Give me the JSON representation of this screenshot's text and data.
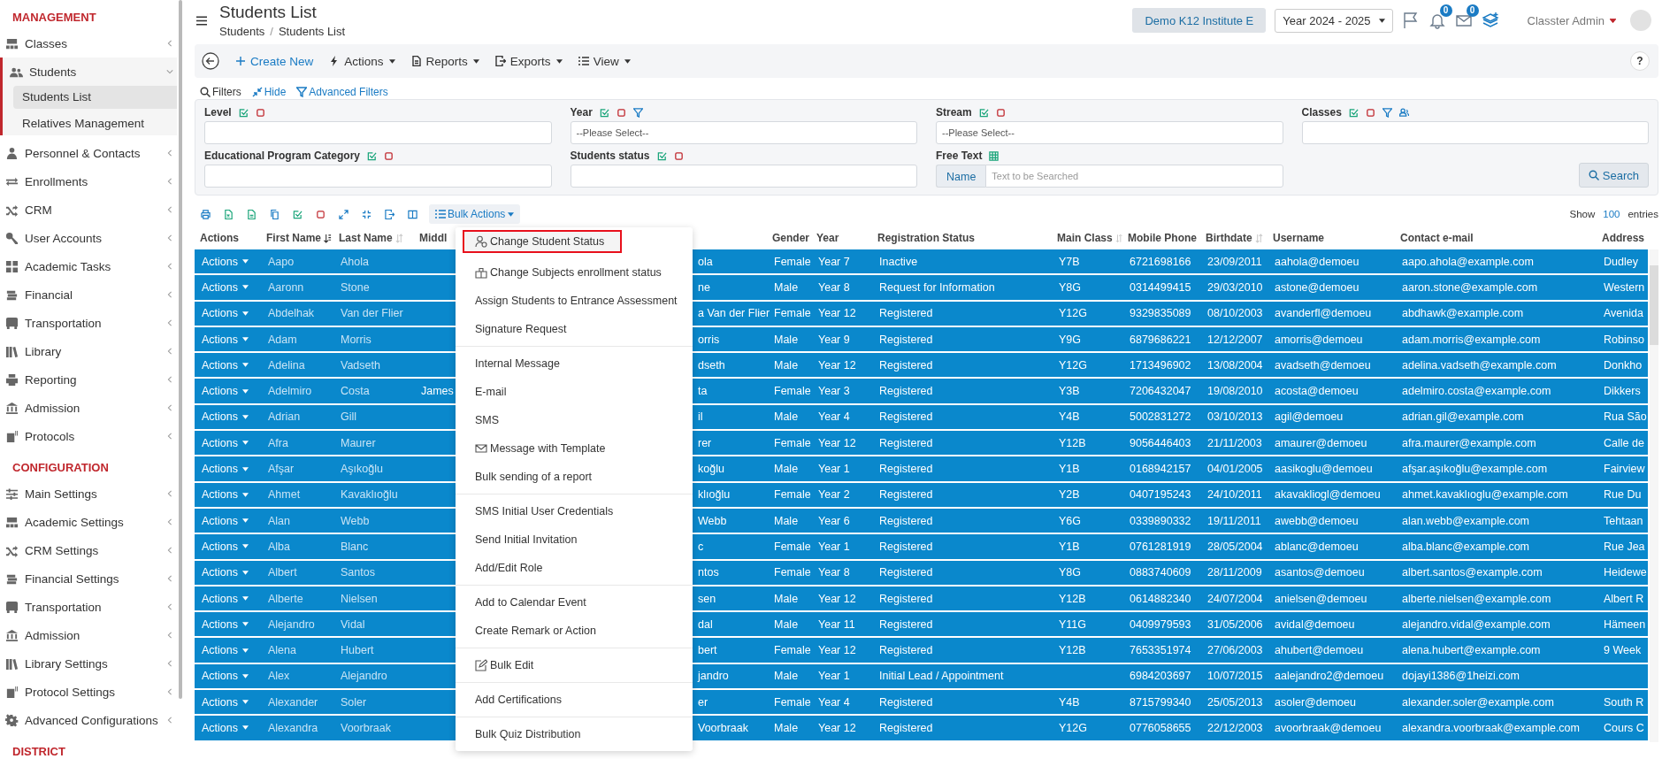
{
  "sidebar": {
    "sections": [
      {
        "title": "MANAGEMENT",
        "items": [
          {
            "label": "Classes",
            "kind": "classroom",
            "expanded": false
          },
          {
            "label": "Students",
            "kind": "people",
            "expanded": true,
            "children": [
              {
                "label": "Students List",
                "selected": true
              },
              {
                "label": "Relatives Management",
                "selected": false
              }
            ]
          },
          {
            "label": "Personnel & Contacts",
            "kind": "person",
            "expanded": false
          },
          {
            "label": "Enrollments",
            "kind": "arrows",
            "expanded": false
          },
          {
            "label": "CRM",
            "kind": "shuffle",
            "expanded": false
          },
          {
            "label": "User Accounts",
            "kind": "key",
            "expanded": false
          },
          {
            "label": "Academic Tasks",
            "kind": "grid",
            "expanded": false
          },
          {
            "label": "Financial",
            "kind": "coins",
            "expanded": false
          },
          {
            "label": "Transportation",
            "kind": "bus",
            "expanded": false
          },
          {
            "label": "Library",
            "kind": "books",
            "expanded": false
          },
          {
            "label": "Reporting",
            "kind": "printer",
            "expanded": false
          },
          {
            "label": "Admission",
            "kind": "bank",
            "expanded": false
          },
          {
            "label": "Protocols",
            "kind": "cabinet",
            "expanded": false
          }
        ]
      },
      {
        "title": "CONFIGURATION",
        "items": [
          {
            "label": "Main Settings",
            "kind": "sliders",
            "expanded": false
          },
          {
            "label": "Academic Settings",
            "kind": "classroom",
            "expanded": false
          },
          {
            "label": "CRM Settings",
            "kind": "shuffle",
            "expanded": false
          },
          {
            "label": "Financial Settings",
            "kind": "coins",
            "expanded": false
          },
          {
            "label": "Transportation",
            "kind": "bus",
            "expanded": false
          },
          {
            "label": "Admission",
            "kind": "bank",
            "expanded": false
          },
          {
            "label": "Library Settings",
            "kind": "books",
            "expanded": false
          },
          {
            "label": "Protocol Settings",
            "kind": "cabinet",
            "expanded": false
          },
          {
            "label": "Advanced Configurations",
            "kind": "gears",
            "expanded": false
          }
        ]
      },
      {
        "title": "DISTRICT"
      }
    ]
  },
  "header": {
    "title": "Students List",
    "breadcrumb": [
      "Students",
      "Students List"
    ],
    "breadcrumb_separator": "/",
    "institute": "Demo K12 Institute E",
    "year": "Year 2024 - 2025",
    "notifications": "0",
    "messages": "0",
    "user": "Classter Admin"
  },
  "toolbar": {
    "buttons": [
      {
        "label": "Create New",
        "kind": "create",
        "caret": false
      },
      {
        "label": "Actions",
        "kind": "bolt",
        "caret": true
      },
      {
        "label": "Reports",
        "kind": "doc",
        "caret": true
      },
      {
        "label": "Exports",
        "kind": "export",
        "caret": true
      },
      {
        "label": "View",
        "kind": "list",
        "caret": true
      }
    ],
    "help": "?"
  },
  "filters": {
    "title": "Filters",
    "hide": "Hide",
    "advanced": "Advanced Filters",
    "fields": [
      {
        "label": "Level",
        "kind": "multi",
        "filter_button": false,
        "group_button": false
      },
      {
        "label": "Year",
        "kind": "multi",
        "filter_button": true,
        "group_button": false,
        "placeholder": "--Please Select--"
      },
      {
        "label": "Stream",
        "kind": "multi",
        "filter_button": false,
        "group_button": false,
        "placeholder": "--Please Select--"
      },
      {
        "label": "Classes",
        "kind": "multi",
        "filter_button": true,
        "group_button": true
      },
      {
        "label": "Educational Program Category",
        "kind": "multi",
        "filter_button": false,
        "group_button": false
      },
      {
        "label": "Students status",
        "kind": "multi",
        "filter_button": false,
        "group_button": false
      },
      {
        "label": "Free Text",
        "kind": "text",
        "addon": "Name",
        "placeholder": "Text to be Searched"
      }
    ],
    "search": "Search"
  },
  "table_tools": {
    "bulk_actions": "Bulk Actions",
    "show": "Show",
    "page_size": "100",
    "entries": "entries"
  },
  "table": {
    "columns": [
      {
        "label": "Actions",
        "kind": "plain"
      },
      {
        "label": "First Name",
        "kind": "sorted"
      },
      {
        "label": "Last Name",
        "kind": "sortable"
      },
      {
        "label": "Middl",
        "kind": "plain"
      },
      {
        "label": "Gender",
        "kind": "plain"
      },
      {
        "label": "Year",
        "kind": "plain"
      },
      {
        "label": "Registration Status",
        "kind": "plain"
      },
      {
        "label": "Main Class",
        "kind": "sortable"
      },
      {
        "label": "Mobile Phone",
        "kind": "plain"
      },
      {
        "label": "Birthdate",
        "kind": "sortable"
      },
      {
        "label": "Username",
        "kind": "plain"
      },
      {
        "label": "Contact e-mail",
        "kind": "plain"
      },
      {
        "label": "Address",
        "kind": "plain"
      }
    ],
    "rows": [
      {
        "selected": true,
        "action": "Actions",
        "first_name": "Aapo",
        "last_name": "Ahola",
        "column_5": "ola",
        "gender": "Female",
        "year": "Year 7",
        "registration_status": "Inactive",
        "main_class": "Y7B",
        "mobile_phone": "6721698166",
        "birthdate": "23/09/2011",
        "username": "aahola@demoeu",
        "contact_email": "aapo.ahola@example.com",
        "address": "Dudley"
      },
      {
        "selected": true,
        "action": "Actions",
        "first_name": "Aaronn",
        "last_name": "Stone",
        "column_5": "ne",
        "gender": "Male",
        "year": "Year 8",
        "registration_status": "Request for Information",
        "main_class": "Y8G",
        "mobile_phone": "0314499415",
        "birthdate": "29/03/2010",
        "username": "astone@demoeu",
        "contact_email": "aaron.stone@example.com",
        "address": "Western"
      },
      {
        "selected": true,
        "action": "Actions",
        "first_name": "Abdelhak",
        "last_name": "Van der Flier",
        "column_5": "a Van der Flier",
        "gender": "Female",
        "year": "Year 12",
        "registration_status": "Registered",
        "main_class": "Y12G",
        "mobile_phone": "9329835089",
        "birthdate": "08/10/2003",
        "username": "avanderfl@demoeu",
        "contact_email": "abdhawk@example.com",
        "address": "Avenida"
      },
      {
        "selected": true,
        "action": "Actions",
        "first_name": "Adam",
        "last_name": "Morris",
        "column_5": "orris",
        "gender": "Male",
        "year": "Year 9",
        "registration_status": "Registered",
        "main_class": "Y9G",
        "mobile_phone": "6879686221",
        "birthdate": "12/12/2007",
        "username": "amorris@demoeu",
        "contact_email": "adam.morris@example.com",
        "address": "Robinso"
      },
      {
        "selected": true,
        "action": "Actions",
        "first_name": "Adelina",
        "last_name": "Vadseth",
        "column_5": "dseth",
        "gender": "Male",
        "year": "Year 12",
        "registration_status": "Registered",
        "main_class": "Y12G",
        "mobile_phone": "1713496902",
        "birthdate": "13/08/2004",
        "username": "avadseth@demoeu",
        "contact_email": "adelina.vadseth@example.com",
        "address": "Donkho"
      },
      {
        "selected": true,
        "action": "Actions",
        "first_name": "Adelmiro",
        "last_name": "Costa",
        "middle_name": "James",
        "column_5": "ta",
        "gender": "Female",
        "year": "Year 3",
        "registration_status": "Registered",
        "main_class": "Y3B",
        "mobile_phone": "7206432047",
        "birthdate": "19/08/2010",
        "username": "acosta@demoeu",
        "contact_email": "adelmiro.costa@example.com",
        "address": "Dikkers"
      },
      {
        "selected": true,
        "action": "Actions",
        "first_name": "Adrian",
        "last_name": "Gill",
        "column_5": "il",
        "gender": "Male",
        "year": "Year 4",
        "registration_status": "Registered",
        "main_class": "Y4B",
        "mobile_phone": "5002831272",
        "birthdate": "03/10/2013",
        "username": "agil@demoeu",
        "contact_email": "adrian.gil@example.com",
        "address": "Rua São"
      },
      {
        "selected": true,
        "action": "Actions",
        "first_name": "Afra",
        "last_name": "Maurer",
        "column_5": "rer",
        "gender": "Female",
        "year": "Year 12",
        "registration_status": "Registered",
        "main_class": "Y12B",
        "mobile_phone": "9056446403",
        "birthdate": "21/11/2003",
        "username": "amaurer@demoeu",
        "contact_email": "afra.maurer@example.com",
        "address": "Calle de"
      },
      {
        "selected": true,
        "action": "Actions",
        "first_name": "Afşar",
        "last_name": "Aşıkoğlu",
        "column_5": "koğlu",
        "gender": "Male",
        "year": "Year 1",
        "registration_status": "Registered",
        "main_class": "Y1B",
        "mobile_phone": "0168942157",
        "birthdate": "04/01/2005",
        "username": "aasikoglu@demoeu",
        "contact_email": "afşar.aşıkoğlu@example.com",
        "address": "Fairview"
      },
      {
        "selected": true,
        "action": "Actions",
        "first_name": "Ahmet",
        "last_name": "Kavaklıoğlu",
        "column_5": "klıoğlu",
        "gender": "Female",
        "year": "Year 2",
        "registration_status": "Registered",
        "main_class": "Y2B",
        "mobile_phone": "0407195243",
        "birthdate": "24/10/2011",
        "username": "akavakliogl@demoeu",
        "contact_email": "ahmet.kavaklıoglu@example.com",
        "address": "Rue Du"
      },
      {
        "selected": true,
        "action": "Actions",
        "first_name": "Alan",
        "last_name": "Webb",
        "column_5": "Webb",
        "gender": "Male",
        "year": "Year 6",
        "registration_status": "Registered",
        "main_class": "Y6G",
        "mobile_phone": "0339890332",
        "birthdate": "19/11/2011",
        "username": "awebb@demoeu",
        "contact_email": "alan.webb@example.com",
        "address": "Tehtaan"
      },
      {
        "selected": true,
        "action": "Actions",
        "first_name": "Alba",
        "last_name": "Blanc",
        "column_5": "c",
        "gender": "Female",
        "year": "Year 1",
        "registration_status": "Registered",
        "main_class": "Y1B",
        "mobile_phone": "0761281919",
        "birthdate": "28/05/2004",
        "username": "ablanc@demoeu",
        "contact_email": "alba.blanc@example.com",
        "address": "Rue Jea"
      },
      {
        "selected": true,
        "action": "Actions",
        "first_name": "Albert",
        "last_name": "Santos",
        "column_5": "ntos",
        "gender": "Female",
        "year": "Year 8",
        "registration_status": "Registered",
        "main_class": "Y8G",
        "mobile_phone": "0883740609",
        "birthdate": "28/11/2009",
        "username": "asantos@demoeu",
        "contact_email": "albert.santos@example.com",
        "address": "Heidewe"
      },
      {
        "selected": true,
        "action": "Actions",
        "first_name": "Alberte",
        "last_name": "Nielsen",
        "column_5": "sen",
        "gender": "Male",
        "year": "Year 12",
        "registration_status": "Registered",
        "main_class": "Y12B",
        "mobile_phone": "0614882340",
        "birthdate": "24/07/2004",
        "username": "anielsen@demoeu",
        "contact_email": "alberte.nielsen@example.com",
        "address": "Albert R"
      },
      {
        "selected": true,
        "action": "Actions",
        "first_name": "Alejandro",
        "last_name": "Vidal",
        "column_5": "dal",
        "gender": "Male",
        "year": "Year 11",
        "registration_status": "Registered",
        "main_class": "Y11G",
        "mobile_phone": "0409979593",
        "birthdate": "31/05/2006",
        "username": "avidal@demoeu",
        "contact_email": "alejandro.vidal@example.com",
        "address": "Hämeen"
      },
      {
        "selected": true,
        "action": "Actions",
        "first_name": "Alena",
        "last_name": "Hubert",
        "column_5": "bert",
        "gender": "Female",
        "year": "Year 12",
        "registration_status": "Registered",
        "main_class": "Y12B",
        "mobile_phone": "7653351974",
        "birthdate": "27/06/2003",
        "username": "ahubert@demoeu",
        "contact_email": "alena.hubert@example.com",
        "address": "9 Week"
      },
      {
        "selected": true,
        "action": "Actions",
        "first_name": "Alex",
        "last_name": "Alejandro",
        "column_5": "jandro",
        "gender": "Male",
        "year": "Year 1",
        "registration_status": "Initial Lead / Appointment",
        "mobile_phone": "6984203697",
        "birthdate": "10/07/2015",
        "username": "aalejandro2@demoeu",
        "contact_email": "dojayi1386@1heizi.com"
      },
      {
        "selected": true,
        "action": "Actions",
        "first_name": "Alexander",
        "last_name": "Soler",
        "column_5": "er",
        "gender": "Female",
        "year": "Year 4",
        "registration_status": "Registered",
        "main_class": "Y4B",
        "mobile_phone": "8715799340",
        "birthdate": "25/05/2013",
        "username": "asoler@demoeu",
        "contact_email": "alexander.soler@example.com",
        "address": "South R"
      },
      {
        "selected": true,
        "action": "Actions",
        "first_name": "Alexandra",
        "last_name": "Voorbraak",
        "column_5": "Voorbraak",
        "gender": "Male",
        "year": "Year 12",
        "registration_status": "Registered",
        "main_class": "Y12G",
        "mobile_phone": "0776058655",
        "birthdate": "22/12/2003",
        "username": "avoorbraak@demoeu",
        "contact_email": "alexandra.voorbraak@example.com",
        "address": "Cours C"
      }
    ]
  },
  "bulk_menu": {
    "groups": [
      [
        {
          "label": "Change Student Status",
          "kind": "person",
          "highlighted": true
        },
        {
          "label": "Change Subjects enrollment status",
          "kind": "briefcase",
          "highlighted": false
        },
        {
          "label": "Assign Students to Entrance Assessment",
          "kind": "text",
          "highlighted": false
        },
        {
          "label": "Signature Request",
          "kind": "text",
          "highlighted": false
        }
      ],
      [
        {
          "label": "Internal Message",
          "kind": "text",
          "highlighted": false
        },
        {
          "label": "E-mail",
          "kind": "text",
          "highlighted": false
        },
        {
          "label": "SMS",
          "kind": "text",
          "highlighted": false
        },
        {
          "label": "Message with Template",
          "kind": "envelope",
          "highlighted": false
        },
        {
          "label": "Bulk sending of a report",
          "kind": "text",
          "highlighted": false
        }
      ],
      [
        {
          "label": "SMS Initial User Credentials",
          "kind": "text",
          "highlighted": false
        },
        {
          "label": "Send Initial Invitation",
          "kind": "text",
          "highlighted": false
        },
        {
          "label": "Add/Edit Role",
          "kind": "text",
          "highlighted": false
        }
      ],
      [
        {
          "label": "Add to Calendar Event",
          "kind": "text",
          "highlighted": false
        },
        {
          "label": "Create Remark or Action",
          "kind": "text",
          "highlighted": false
        }
      ],
      [
        {
          "label": "Bulk Edit",
          "kind": "pencil",
          "highlighted": false
        }
      ],
      [
        {
          "label": "Add Certifications",
          "kind": "text",
          "highlighted": false
        }
      ],
      [
        {
          "label": "Bulk Quiz Distribution",
          "kind": "text",
          "highlighted": false
        }
      ]
    ]
  }
}
